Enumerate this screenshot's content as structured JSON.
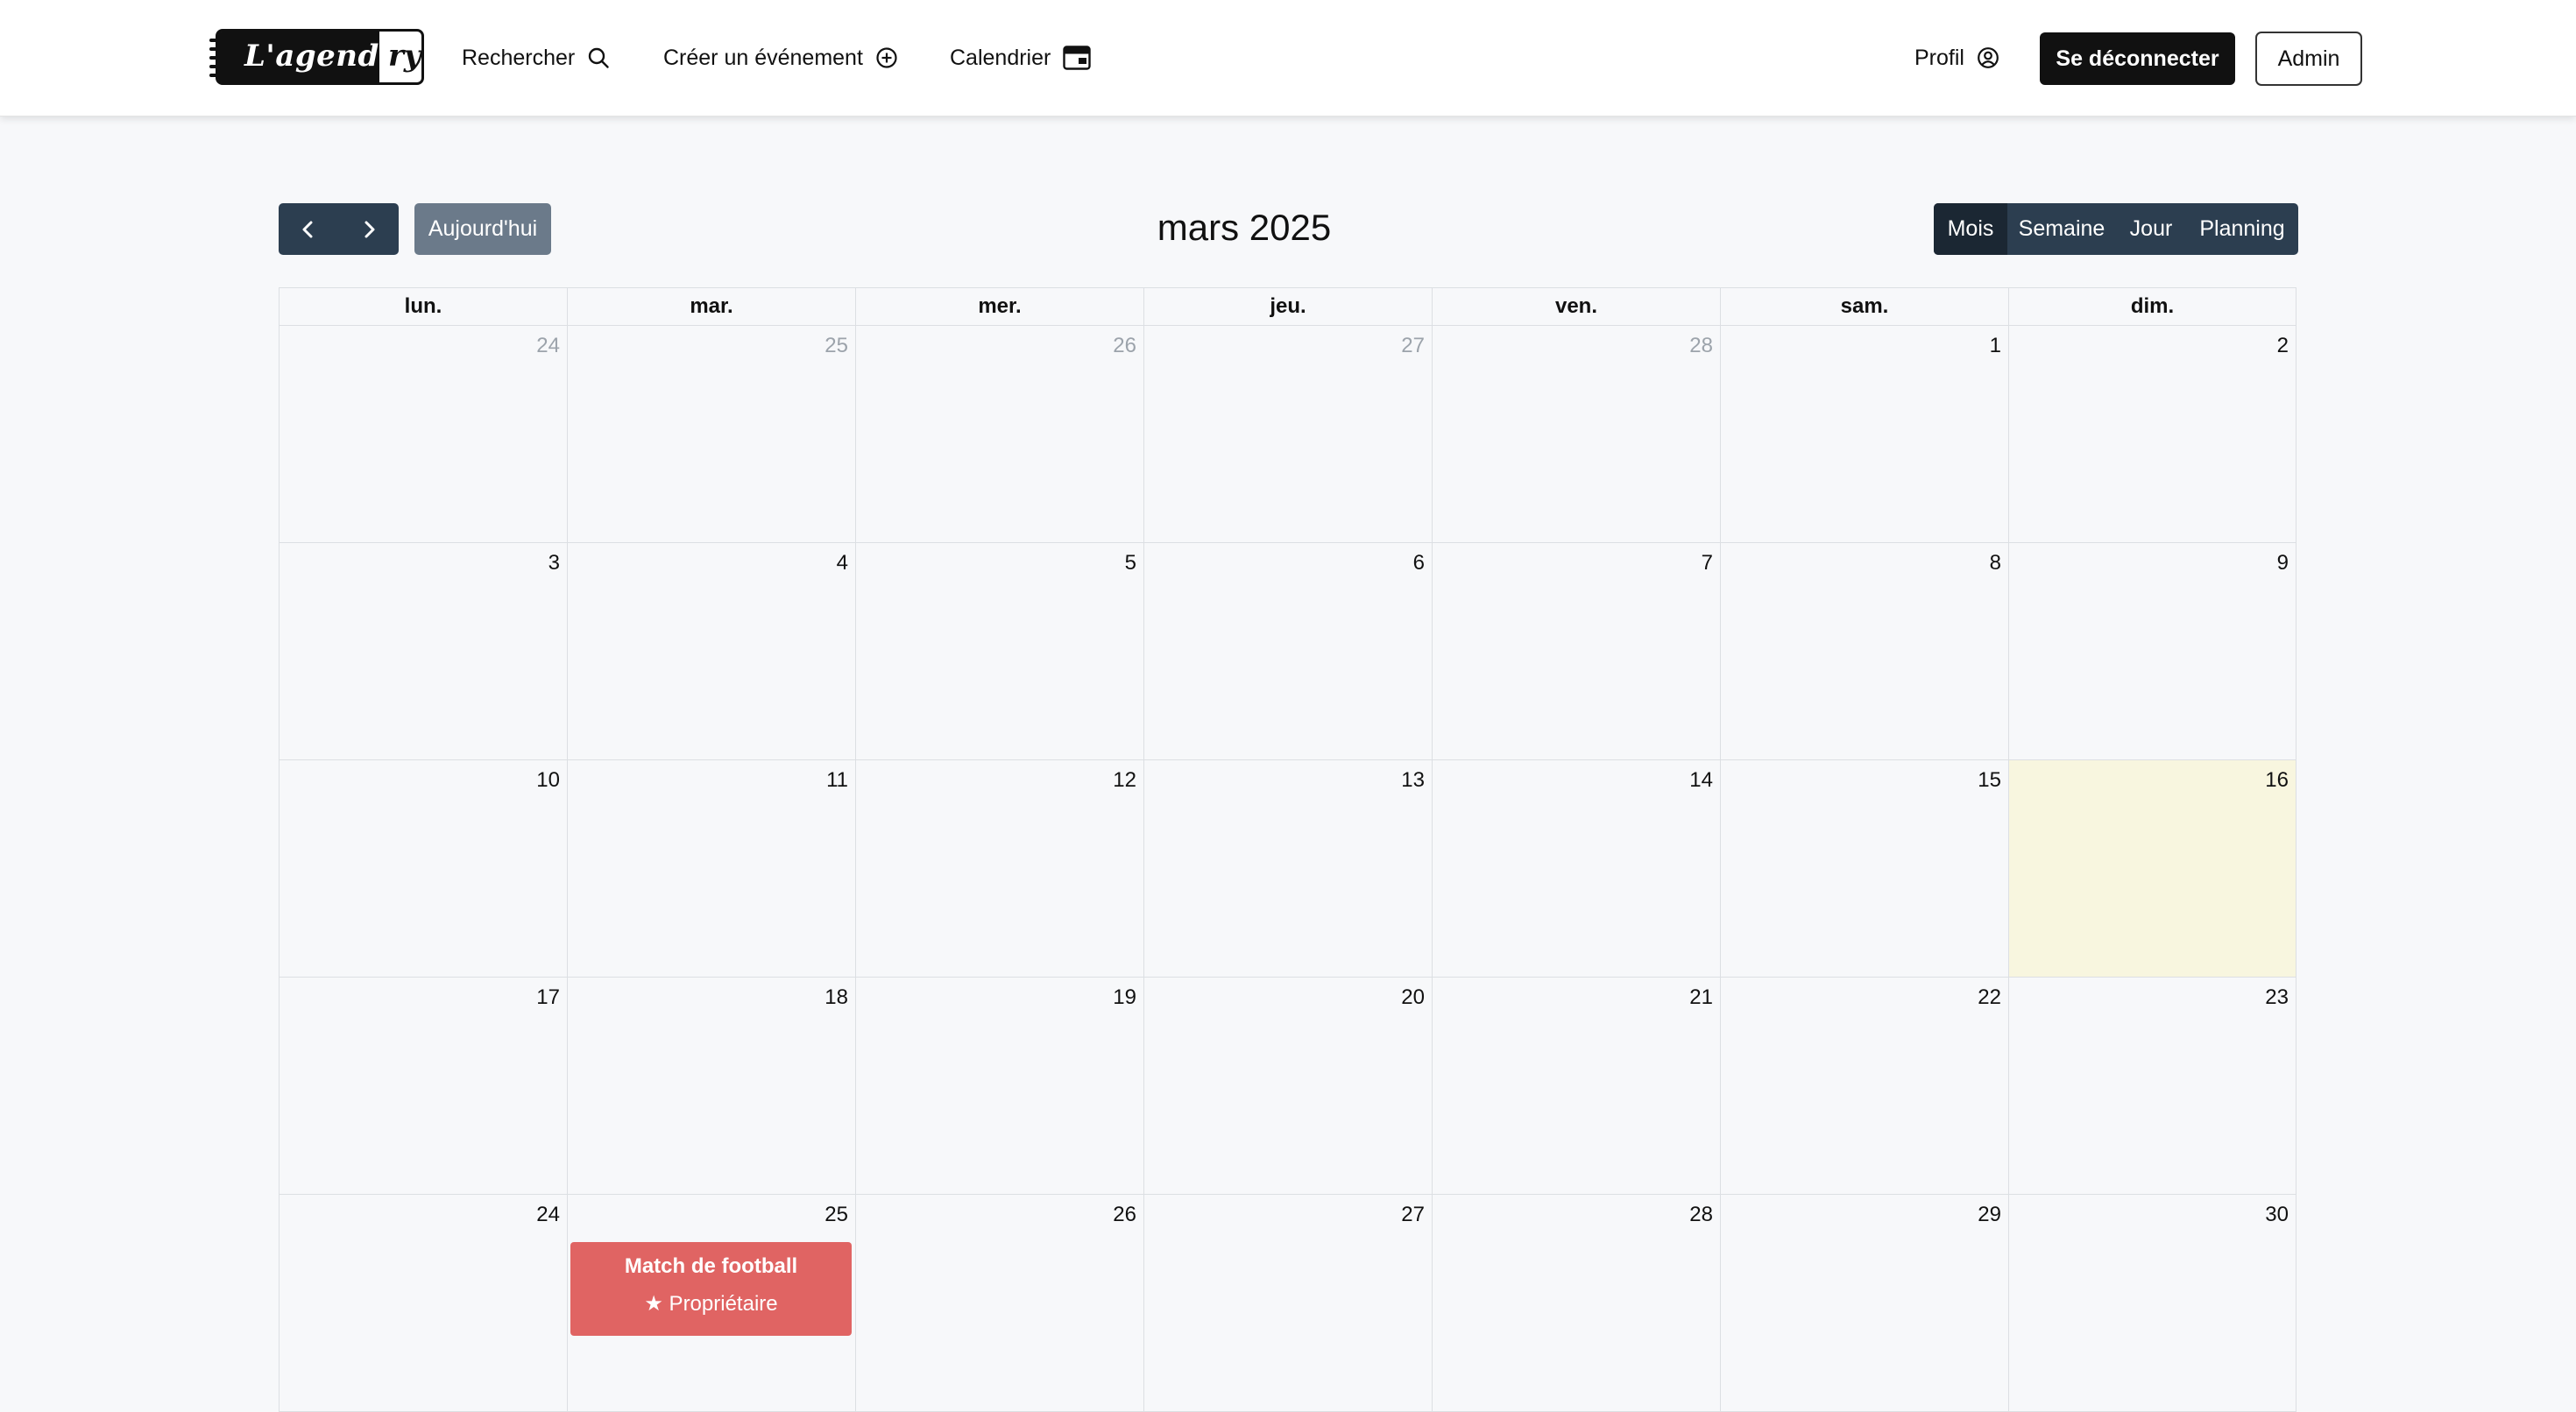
{
  "brand": {
    "logo_text_white": "L'agenda",
    "logo_text_dark": "ry"
  },
  "nav": {
    "search_label": "Rechercher",
    "create_event_label": "Créer un événement",
    "calendar_label": "Calendrier",
    "profile_label": "Profil",
    "logout_label": "Se déconnecter",
    "admin_label": "Admin"
  },
  "toolbar": {
    "prev_icon": "chevron-left-icon",
    "next_icon": "chevron-right-icon",
    "today_label": "Aujourd'hui",
    "title": "mars 2025",
    "views": [
      "Mois",
      "Semaine",
      "Jour",
      "Planning"
    ],
    "active_view": "Mois"
  },
  "calendar": {
    "weekdays": [
      "lun.",
      "mar.",
      "mer.",
      "jeu.",
      "ven.",
      "sam.",
      "dim."
    ],
    "weeks": [
      [
        "24",
        "25",
        "26",
        "27",
        "28",
        "1",
        "2"
      ],
      [
        "3",
        "4",
        "5",
        "6",
        "7",
        "8",
        "9"
      ],
      [
        "10",
        "11",
        "12",
        "13",
        "14",
        "15",
        "16"
      ],
      [
        "17",
        "18",
        "19",
        "20",
        "21",
        "22",
        "23"
      ],
      [
        "24",
        "25",
        "26",
        "27",
        "28",
        "29",
        "30"
      ]
    ],
    "today": "16",
    "event": {
      "title": "Match de football",
      "role": "★  Propriétaire",
      "date": "25",
      "color": "#e06463"
    }
  },
  "colors": {
    "navbar_bg": "#ffffff",
    "button_dark": "#2c3e50",
    "today_highlight": "#f8f6df",
    "event": "#e06463"
  }
}
